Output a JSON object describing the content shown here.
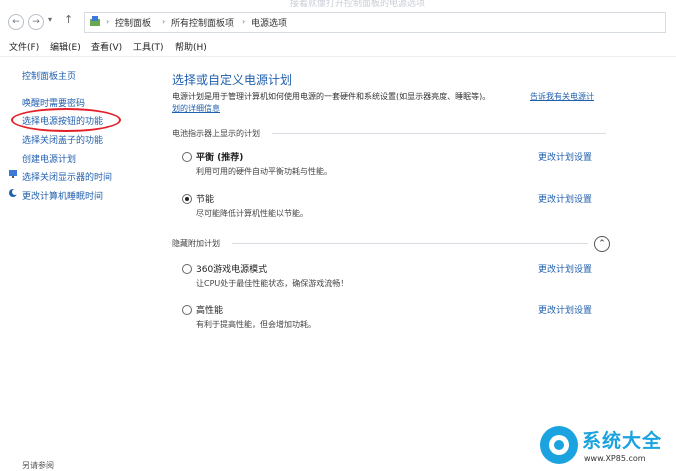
{
  "top_strip_text": "接着就像打开控制面板的电源选项",
  "address": {
    "back": "←",
    "forward": "→",
    "dropdown": "▾",
    "up": "↑",
    "sep": "›",
    "crumbs": [
      "控制面板",
      "所有控制面板项",
      "电源选项"
    ]
  },
  "menu": [
    "文件(F)",
    "编辑(E)",
    "查看(V)",
    "工具(T)",
    "帮助(H)"
  ],
  "sidebar": {
    "home": "控制面板主页",
    "items": [
      "唤醒时需要密码",
      "选择电源按钮的功能",
      "选择关闭盖子的功能",
      "创建电源计划",
      "选择关闭显示器的时间",
      "更改计算机睡眠时间"
    ]
  },
  "main": {
    "title": "选择或自定义电源计划",
    "desc": "电源计划是用于管理计算机如何使用电源的一套硬件和系统设置(如显示器亮度、睡眠等)。",
    "desc_link": "告诉我有关电源计",
    "desc_link2": "划的详细信息",
    "section1": "电池指示器上显示的计划",
    "section2": "隐藏附加计划",
    "collapse_glyph": "⌃",
    "plans": [
      {
        "name": "平衡 (推荐)",
        "desc": "利用可用的硬件自动平衡功耗与性能。",
        "link": "更改计划设置",
        "selected": false
      },
      {
        "name": "节能",
        "desc": "尽可能降低计算机性能以节能。",
        "link": "更改计划设置",
        "selected": true
      },
      {
        "name": "360游戏电源模式",
        "desc": "让CPU处于最佳性能状态，确保游戏流畅！",
        "link": "更改计划设置",
        "selected": false
      },
      {
        "name": "高性能",
        "desc": "有利于提高性能，但会增加功耗。",
        "link": "更改计划设置",
        "selected": false
      }
    ]
  },
  "see_also": "另请参阅",
  "watermark": {
    "text": "系统大全",
    "url": "www.XP85.com"
  },
  "colors": {
    "link": "#1f5fae",
    "highlight_circle": "#e3202a",
    "watermark": "#1aa3df"
  }
}
